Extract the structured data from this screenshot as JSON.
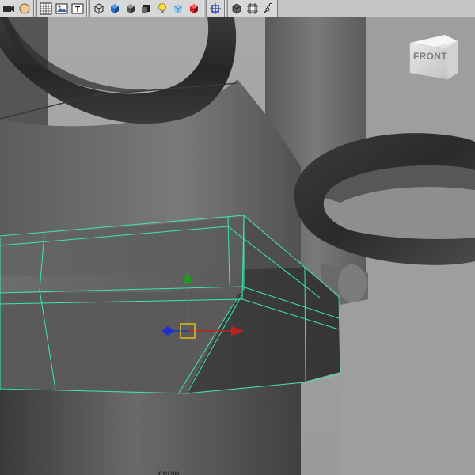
{
  "viewport": {
    "camera_name": "persp",
    "view_cube_face": "FRONT"
  },
  "colors": {
    "selection_wire": "#3ee8a8",
    "manip_x": "#c02020",
    "manip_y": "#18a018",
    "manip_z": "#2030d0",
    "manip_center": "#e0c020"
  },
  "toolbar": {
    "buttons": [
      {
        "name": "select-camera-icon"
      },
      {
        "name": "camera-attributes-icon"
      },
      {
        "name": "grid-toggle-icon"
      },
      {
        "name": "image-plane-icon"
      },
      {
        "name": "2d-pan-zoom-icon"
      },
      {
        "name": "wireframe-icon"
      },
      {
        "name": "smooth-shade-icon"
      },
      {
        "name": "default-material-icon"
      },
      {
        "name": "shadows-icon"
      },
      {
        "name": "lighting-icon"
      },
      {
        "name": "xray-icon"
      },
      {
        "name": "textured-icon"
      },
      {
        "name": "isolate-select-icon"
      },
      {
        "name": "xray-joints-icon"
      },
      {
        "name": "resolution-gate-icon"
      },
      {
        "name": "film-gate-icon"
      }
    ]
  }
}
